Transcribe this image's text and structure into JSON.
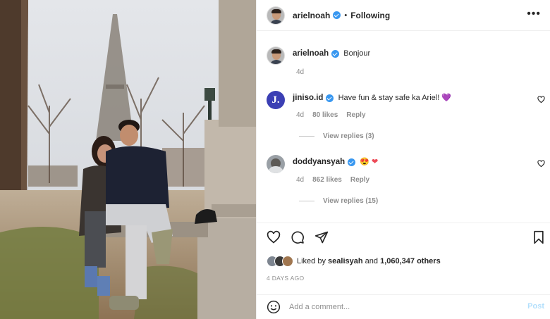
{
  "post": {
    "author": "arielnoah",
    "follow_status": "Following",
    "more_icon": "more-horizontal-icon"
  },
  "caption": {
    "author": "arielnoah",
    "text": "Bonjour",
    "age": "4d"
  },
  "comments": [
    {
      "author": "jiniso.id",
      "avatar_letter": "J.",
      "text": "Have fun & stay safe ka Ariel!",
      "emoji": "💜",
      "age": "4d",
      "likes": "80 likes",
      "reply_label": "Reply",
      "view_replies": "View replies (3)"
    },
    {
      "author": "doddyansyah",
      "text": "",
      "emoji": "😍 ❤",
      "age": "4d",
      "likes": "862 likes",
      "reply_label": "Reply",
      "view_replies": "View replies (15)"
    }
  ],
  "likes": {
    "prefix": "Liked by",
    "first_user": "sealisyah",
    "connector": "and",
    "others": "1,060,347 others"
  },
  "date": "4 DAYS AGO",
  "comment_box": {
    "placeholder": "Add a comment...",
    "post_label": "Post"
  },
  "colors": {
    "verified": "#3897f0",
    "link_disabled": "#b2dffc",
    "secondary_text": "#8e8e8e"
  }
}
